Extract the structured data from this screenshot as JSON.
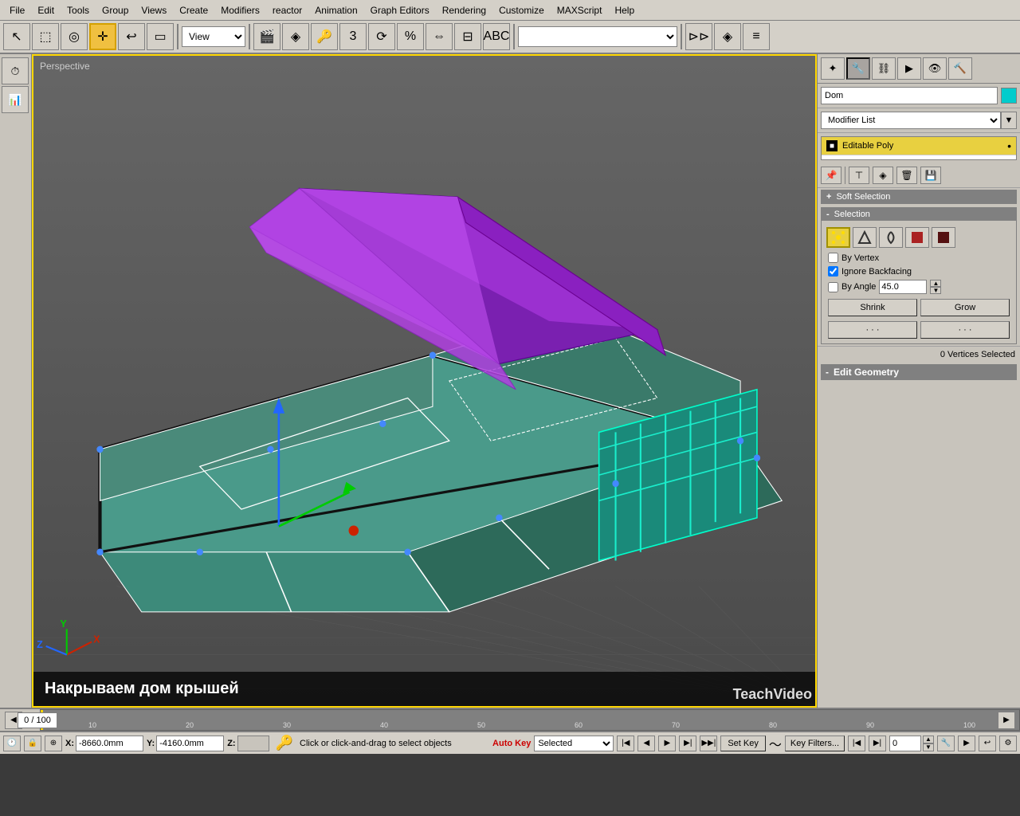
{
  "menubar": {
    "items": [
      "File",
      "Edit",
      "Tools",
      "Group",
      "Views",
      "Create",
      "Modifiers",
      "reactor",
      "Animation",
      "Graph Editors",
      "Rendering",
      "Customize",
      "MAXScript",
      "Help"
    ]
  },
  "toolbar": {
    "view_label": "View",
    "icons": [
      "▣",
      "◉",
      "✛",
      "↩",
      "▭"
    ]
  },
  "viewport": {
    "label": "Perspective",
    "subtitle": "Накрываем дом крышей"
  },
  "right_panel": {
    "object_name": "Dom",
    "modifier_list_label": "Modifier List",
    "modifier_stack_item": "Editable Poly",
    "sections": {
      "soft_selection": {
        "label": "Soft Selection",
        "toggle": "+"
      },
      "selection": {
        "label": "Selection",
        "toggle": "-",
        "by_vertex_label": "By Vertex",
        "ignore_backfacing_label": "Ignore Backfacing",
        "by_angle_label": "By Angle",
        "by_angle_value": "45.0",
        "shrink_label": "Shrink",
        "grow_label": "Grow"
      },
      "edit_geometry": {
        "label": "Edit Geometry",
        "toggle": "-"
      }
    },
    "vertices_selected": "0 Vertices Selected"
  },
  "status_bar": {
    "x_label": "X:",
    "x_value": "-8660.0mm",
    "y_label": "Y:",
    "y_value": "-4160.0mm",
    "z_label": "Z:",
    "z_value": "",
    "status_text": "Click or click-and-drag to select objects",
    "auto_key_label": "Auto Key",
    "selected_label": "Selected",
    "set_key_label": "Set Key",
    "key_filters_label": "Key Filters...",
    "frame_value": "0",
    "timeline_position": "0 / 100"
  },
  "logo": {
    "text1": "Teach",
    "text2": "Video"
  }
}
